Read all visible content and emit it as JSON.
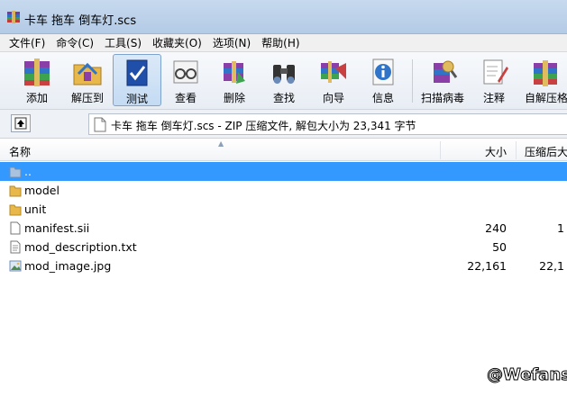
{
  "window": {
    "title": "卡车 拖车 倒车灯.scs"
  },
  "menu": [
    "文件(F)",
    "命令(C)",
    "工具(S)",
    "收藏夹(O)",
    "选项(N)",
    "帮助(H)"
  ],
  "toolbar": {
    "add": "添加",
    "extract": "解压到",
    "test": "测试",
    "view": "查看",
    "delete": "删除",
    "find": "查找",
    "wizard": "向导",
    "info": "信息",
    "scan": "扫描病毒",
    "comment": "注释",
    "sfx": "自解压格"
  },
  "address": {
    "path": "卡车 拖车 倒车灯.scs - ZIP 压缩文件, 解包大小为 23,341 字节"
  },
  "columns": {
    "name": "名称",
    "size": "大小",
    "packed": "压缩后大"
  },
  "files": [
    {
      "name": "..",
      "size": "",
      "packed": "",
      "icon": "folder-up-icon",
      "selected": true
    },
    {
      "name": "model",
      "size": "",
      "packed": "",
      "icon": "folder-icon",
      "selected": false
    },
    {
      "name": "unit",
      "size": "",
      "packed": "",
      "icon": "folder-icon",
      "selected": false
    },
    {
      "name": "manifest.sii",
      "size": "240",
      "packed": "1",
      "icon": "file-icon",
      "selected": false
    },
    {
      "name": "mod_description.txt",
      "size": "50",
      "packed": "",
      "icon": "text-file-icon",
      "selected": false
    },
    {
      "name": "mod_image.jpg",
      "size": "22,161",
      "packed": "22,1",
      "icon": "image-file-icon",
      "selected": false
    }
  ],
  "watermark": "@Wefans",
  "colors": {
    "selection": "#3399ff",
    "titlebar": "#c6d9ee",
    "folder": "#e8b84a"
  }
}
